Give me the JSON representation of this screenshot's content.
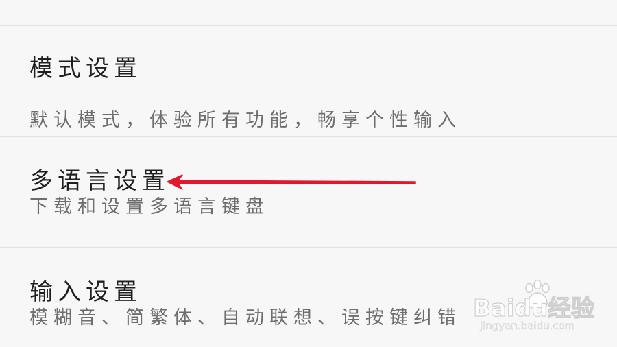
{
  "settings": {
    "items": [
      {
        "title": "模式设置",
        "description": "默认模式，体验所有功能，畅享个性输入"
      },
      {
        "title": "多语言设置",
        "description": "下载和设置多语言键盘"
      },
      {
        "title": "输入设置",
        "description": "模糊音、简繁体、自动联想、误按键纠错"
      }
    ]
  },
  "annotation": {
    "arrow_color": "#e0192e"
  },
  "watermark": {
    "logo_text": "Baidu经验",
    "url": "jingyan.baidu.com"
  }
}
